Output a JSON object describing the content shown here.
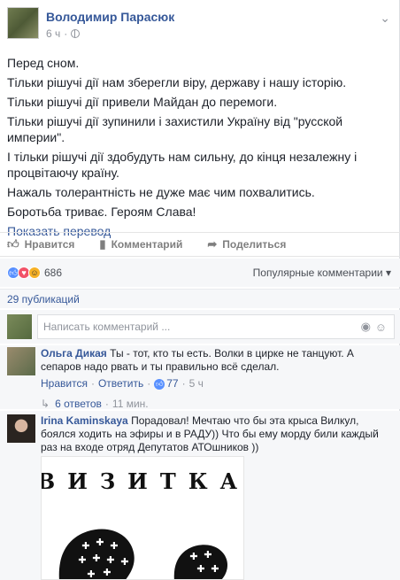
{
  "post": {
    "author": "Володимир Парасюк",
    "time": "6 ч",
    "text_lines": [
      "Перед сном.",
      "Тільки рішучі дії нам зберегли віру, державу і нашу історію.",
      "Тільки рішучі дії привели Майдан до перемоги.",
      "Тільки рішучі дії зупинили і захистили Україну від \"русской империи\".",
      "І тільки рішучі дії здобудуть нам сильну, до кінця незалежну і процвітаючу країну.",
      "Нажаль толерантність не дуже має чим похвалитись.",
      "Боротьба триває. Героям Слава!"
    ],
    "translate_label": "Показать перевод"
  },
  "actions": {
    "like": "Нравится",
    "comment": "Комментарий",
    "share": "Поделиться"
  },
  "reactions": {
    "count": "686",
    "sort_label": "Популярные комментарии"
  },
  "publications": "29 публикаций",
  "composer": {
    "placeholder": "Написать комментарий ..."
  },
  "comments": [
    {
      "name": "Ольга Дикая",
      "text": "Ты - тот, кто ты есть. Волки в цирке не танцуют. А сепаров надо рвать и ты правильно всё сделал.",
      "like_label": "Нравится",
      "reply_label": "Ответить",
      "likes": "77",
      "time": "5 ч",
      "replies": "6 ответов",
      "replies_time": "11 мин."
    },
    {
      "name": "Irina Kaminskaya",
      "text": "Порадовал! Мечтаю что бы эта крыса Вилкул, боялся ходить на эфиры и в РАДУ)) Что бы ему морду били каждый раз на входе отряд Депутатов АТОшников ))",
      "image_caption": "ВИЗИТКА"
    }
  ],
  "icons": {
    "like": "thumbs-up-icon",
    "comment": "speech-bubble-icon",
    "share": "share-arrow-icon",
    "camera": "camera-icon",
    "emoji": "smiley-icon"
  }
}
